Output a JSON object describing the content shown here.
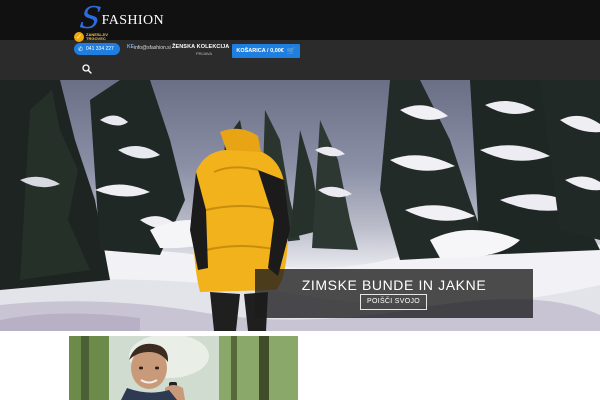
{
  "header": {
    "logo_initial": "S",
    "logo_text": "FASHION",
    "badge_text": "ZANESLJIV\nTRGOVEC",
    "phone": "041 334 227",
    "nav_fragment": "KE",
    "email": "info@sfashion.si",
    "nav_item": "ŽENSKA KOLEKCIJA",
    "nav_small": "PRIJAVA",
    "cart_label": "KOŠARICA / 0,00€",
    "icons": {
      "search": "search-icon",
      "cart": "cart-icon",
      "phone": "phone-icon",
      "badge": "check-badge-icon"
    }
  },
  "hero": {
    "title": "ZIMSKE BUNDE IN JAKNE",
    "button_label": "POIŠČI SVOJO"
  },
  "colors": {
    "accent_blue": "#1e7fe0",
    "header_bg": "#111111",
    "nav_bg": "#2b2b2b",
    "jacket_yellow": "#f2b21c",
    "badge_orange": "#f1a80f"
  }
}
